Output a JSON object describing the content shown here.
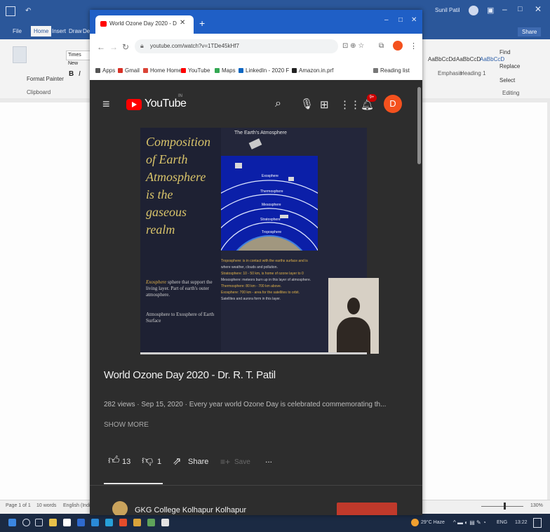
{
  "word": {
    "title": "",
    "tabs": [
      "File",
      "Home",
      "Insert",
      "Draw",
      "Design"
    ],
    "ribbon": {
      "font_box": "Times New",
      "format_painter": "Format Painter",
      "clipboard": "Clipboard",
      "styles": [
        "AaBbCcDd",
        "AaBbCcD",
        "AaBbCcD"
      ],
      "style_names": [
        "Emphasis",
        "Heading 1"
      ],
      "find": "Find",
      "replace": "Replace",
      "select": "Select",
      "editing": "Editing",
      "share": "Share"
    },
    "status": {
      "page": "Page 1 of 1",
      "words": "10 words",
      "language": "English (India)",
      "zoom": "130%"
    }
  },
  "taskbar": {
    "weather": "29°C Haze",
    "lang": "ENG",
    "time": "13:22"
  },
  "browser": {
    "tab_title": "World Ozone Day 2020 - D",
    "url": "youtube.com/watch?v=1TDe45kHf7",
    "bookmarks": [
      "Apps",
      "Gmail",
      "Home Home",
      "YouTube",
      "Maps",
      "LinkedIn - 2020 F",
      "Amazon.in.prf"
    ],
    "reading_list": "Reading list"
  },
  "youtube": {
    "logo": "YouTube",
    "logo_sup": "IN",
    "avatar_letter": "D",
    "notification_count": "9+",
    "slide": {
      "title_lines": [
        "Composition",
        "of Earth",
        "Atmosphere",
        "is the",
        "gaseous",
        "realm"
      ],
      "note1_head": "Exosphere",
      "note1": "sphere that support the living layer. Part of earth's outer atmosphere.",
      "note2": "Atmosphere to Exosphere of Earth Surface",
      "diagram_title": "The Earth's Atmosphere",
      "layers": [
        "Exosphere",
        "Thermosphere",
        "Mesosphere",
        "Stratosphere",
        "Troposphere"
      ],
      "bullets": [
        "Troposphere: is in contact with the earths surface and is",
        "where weather, clouds and pollution.",
        "Stratosphere: 10 - 50 km, is home of ozone layer to 0",
        "Mesosphere: meteors burn up in this layer of atmosphere.",
        "Thermosphere: 80 km - 700 km above.",
        "Exosphere: 700 km - area for the satellites to orbit.",
        "Satellites and aurora form in this layer."
      ]
    },
    "video_title": "World Ozone Day 2020 - Dr. R. T. Patil",
    "meta": "282 views · Sep 15, 2020 · Every year world Ozone Day is celebrated commemorating th...",
    "show_more": "SHOW MORE",
    "likes": "13",
    "dislikes": "1",
    "share": "Share",
    "save": "Save",
    "more": "...",
    "channel": "GKG College Kolhapur Kolhapur"
  },
  "colors": {
    "word_blue": "#2b579a",
    "chrome_blue": "#1f5fc6",
    "yt_red": "#ff0000",
    "avatar": "#f4511e"
  }
}
